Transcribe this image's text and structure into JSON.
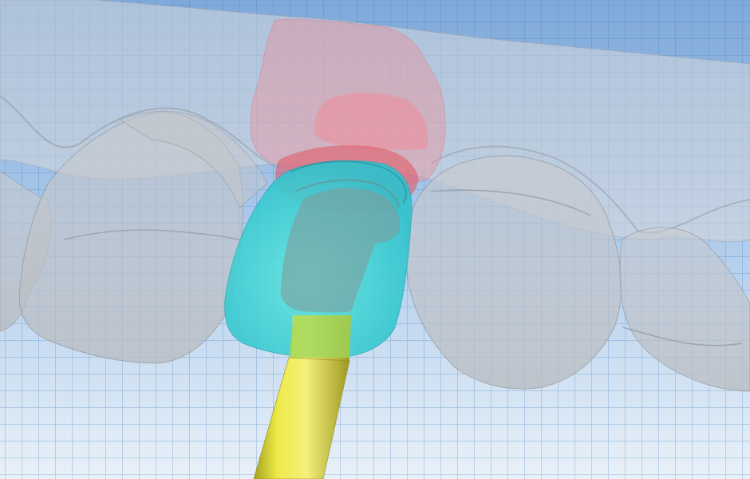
{
  "viewport": {
    "background_top": "#7ea9da",
    "background_bottom": "#e9f1f8",
    "grid_color": "#3f7fbe"
  },
  "scene": {
    "models": [
      {
        "name": "gingiva-model",
        "color": "#d5d7da"
      },
      {
        "name": "abutment",
        "color": "#47d8da"
      },
      {
        "name": "implant-post",
        "color": "#eeea4a"
      },
      {
        "name": "soft-tissue-margin",
        "color": "#f08c97"
      }
    ]
  }
}
